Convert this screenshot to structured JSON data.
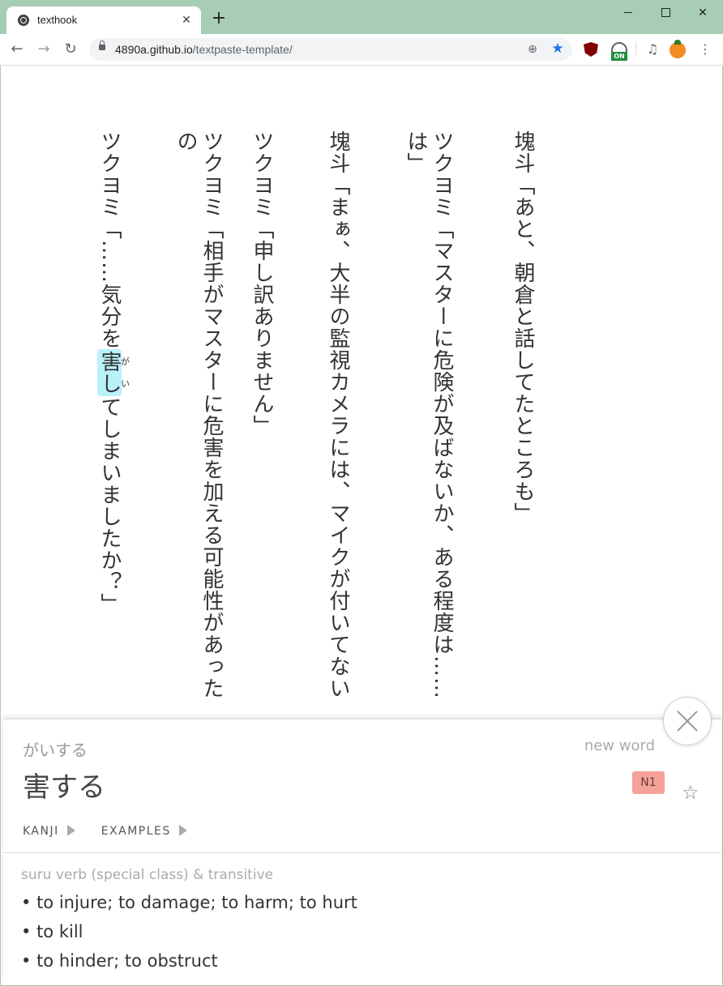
{
  "browser": {
    "tab_title": "texthook",
    "url_host": "4890a.github.io",
    "url_path": "/textpaste-template/",
    "extension_badge": "ON"
  },
  "text_columns": [
    {
      "lines": [
        "塊斗「あと、朝倉と話してたところも」"
      ]
    },
    {
      "lines": [
        "ツクヨミ「マスターに危険が及ばないか、ある程度は……",
        "は」"
      ]
    },
    {
      "lines": [
        "塊斗「まぁ、大半の監視カメラには、マイクが付いてない"
      ]
    },
    {
      "lines": [
        "ツクヨミ「申し訳ありません」"
      ]
    },
    {
      "lines": [
        "ツクヨミ「相手がマスターに危害を加える可能性があったの"
      ]
    },
    {
      "before": "ツクヨミ「……気分を",
      "highlight": "害し",
      "furigana": "がい",
      "after": "てしまいましたか？」"
    }
  ],
  "popup": {
    "reading": "がいする",
    "word": "害する",
    "status": "new word",
    "jlpt": "N1",
    "tabs": [
      "KANJI",
      "EXAMPLES"
    ],
    "part_of_speech": "suru verb (special class) & transitive",
    "definitions": [
      "to injure; to damage; to harm; to hurt",
      "to kill",
      "to hinder; to obstruct"
    ]
  }
}
